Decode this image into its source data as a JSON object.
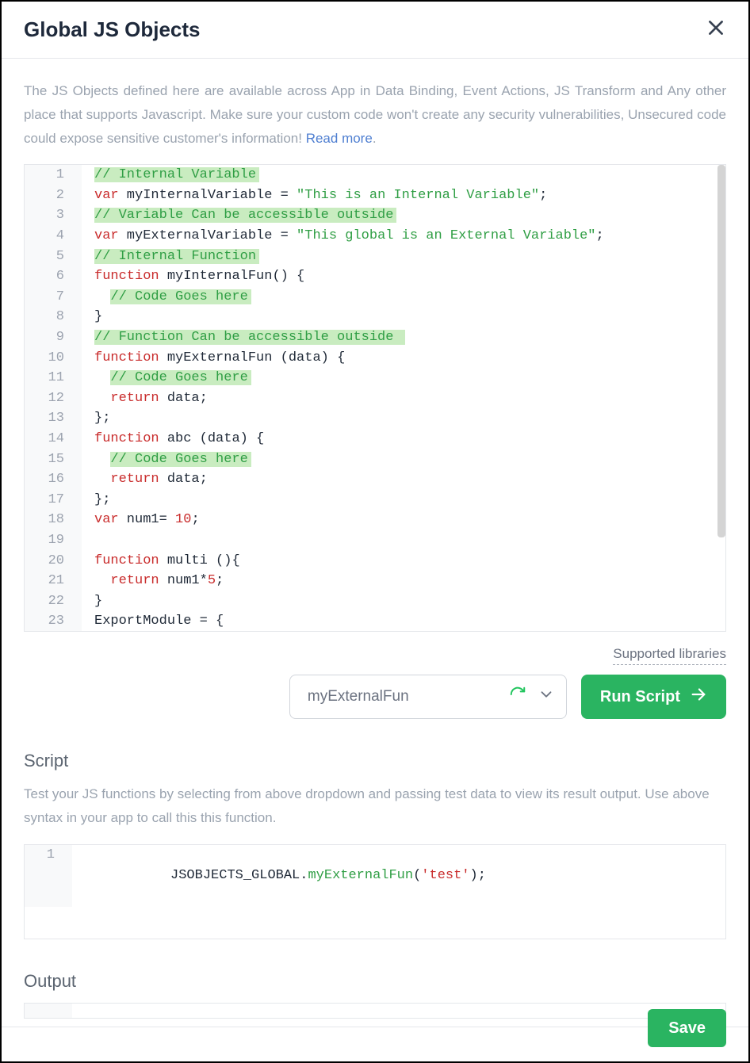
{
  "header": {
    "title": "Global JS Objects"
  },
  "description": {
    "text": "The JS Objects defined here are available across App in Data Binding, Event Actions, JS Transform and Any other place that supports Javascript. Make sure your custom code won't create any security vulnerabilities, Unsecured code could expose sensitive customer's information! ",
    "link_label": "Read more"
  },
  "editor": {
    "lines": {
      "1": "// Internal Variable",
      "2a": "var",
      "2b": " myInternalVariable = ",
      "2c": "\"This is an Internal Variable\"",
      "2d": ";",
      "3": "// Variable Can be accessible outside",
      "4a": "var",
      "4b": " myExternalVariable = ",
      "4c": "\"This global is an External Variable\"",
      "4d": ";",
      "5": "// Internal Function",
      "6a": "function",
      "6b": " myInternalFun",
      "6c": "() {",
      "7": "// Code Goes here",
      "8": "}",
      "9": "// Function Can be accessible outside ",
      "10a": "function",
      "10b": " myExternalFun ",
      "10c": "(data) {",
      "11": "// Code Goes here",
      "12a": "return",
      "12b": " data;",
      "13": "};",
      "14a": "function",
      "14b": " abc ",
      "14c": "(data) {",
      "15": "// Code Goes here",
      "16a": "return",
      "16b": " data;",
      "17": "};",
      "18a": "var",
      "18b": " num1= ",
      "18c": "10",
      "18d": ";",
      "19": "",
      "20a": "function",
      "20b": " multi ",
      "20c": "(){",
      "21a": "return",
      "21b": " num1*",
      "21c": "5",
      "21d": ";",
      "22": "}",
      "23": "ExportModule = {"
    },
    "gutter": [
      "1",
      "2",
      "3",
      "4",
      "5",
      "6",
      "7",
      "8",
      "9",
      "10",
      "11",
      "12",
      "13",
      "14",
      "15",
      "16",
      "17",
      "18",
      "19",
      "20",
      "21",
      "22",
      "23"
    ]
  },
  "supported_libraries_label": "Supported libraries",
  "run": {
    "selected_function": "myExternalFun",
    "button_label": "Run Script"
  },
  "script_section": {
    "title": "Script",
    "description": "Test your JS functions by selecting from above dropdown and passing test data to view its result output. Use above syntax in your app to call this this function.",
    "line_no": "1",
    "call_prefix": "JSOBJECTS_GLOBAL",
    "call_dot": ".",
    "call_fn": "myExternalFun",
    "call_open": "(",
    "call_arg": "'test'",
    "call_close": ");"
  },
  "output_section": {
    "title": "Output"
  },
  "footer": {
    "save_label": "Save"
  },
  "icons": {
    "close": "close-icon",
    "refresh": "refresh-icon",
    "chevron": "chevron-down-icon",
    "arrow_right": "arrow-right-icon"
  },
  "colors": {
    "accent_green": "#2ab461",
    "link_blue": "#4f7fd1"
  }
}
